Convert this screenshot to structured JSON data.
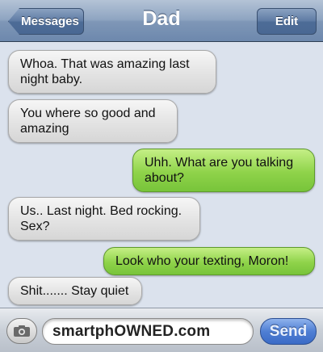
{
  "header": {
    "back_label": "Messages",
    "title": "Dad",
    "edit_label": "Edit"
  },
  "messages": [
    {
      "side": "received",
      "lines": [
        "Whoa. That was amazing last",
        "night baby."
      ]
    },
    {
      "side": "received",
      "lines": [
        "You where so good and",
        "amazing"
      ]
    },
    {
      "side": "sent",
      "lines": [
        "Uhh. What are you talking",
        "about?"
      ]
    },
    {
      "side": "received",
      "lines": [
        "Us.. Last night. Bed rocking.",
        "Sex?"
      ]
    },
    {
      "side": "sent",
      "lines": [
        "Look who your texting, Moron!"
      ]
    },
    {
      "side": "received",
      "lines": [
        "Shit....... Stay quiet"
      ]
    }
  ],
  "composer": {
    "field_text": "smartphOWNED.com",
    "send_label": "Send",
    "camera_icon": "camera-icon"
  },
  "colors": {
    "received_bubble": "#e3e3e3",
    "sent_bubble": "#8fd34a",
    "background": "#dbe2ed"
  }
}
